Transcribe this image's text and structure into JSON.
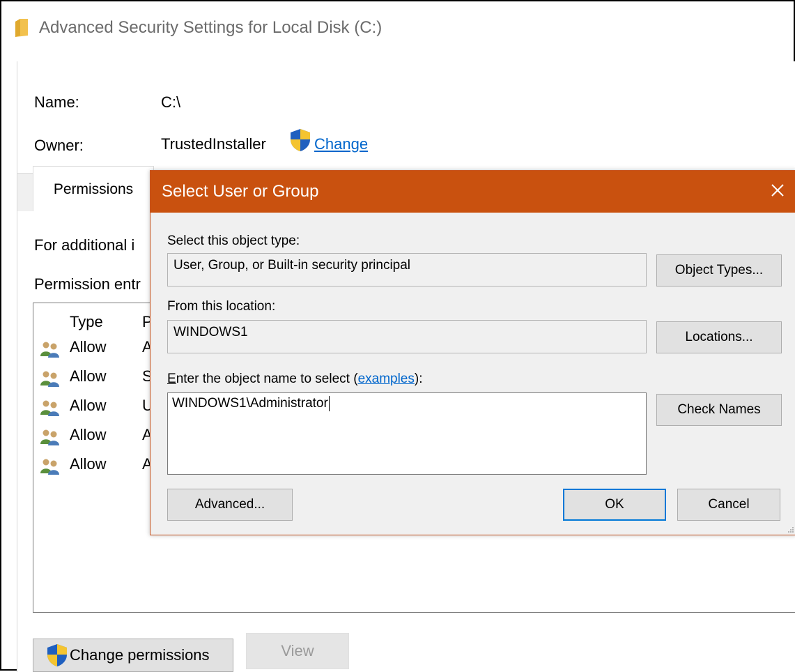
{
  "window": {
    "title": "Advanced Security Settings for Local Disk (C:)",
    "folder_icon_color": "#f2c14e"
  },
  "info": {
    "name_label": "Name:",
    "name_value": "C:\\",
    "owner_label": "Owner:",
    "owner_value": "TrustedInstaller",
    "change_link": "Change"
  },
  "tabs": [
    {
      "label": "Permissions"
    }
  ],
  "permissions_tab": {
    "info_text": "For additional i",
    "entries_text": "Permission entr",
    "columns": [
      "Type",
      "P"
    ],
    "rows": [
      {
        "type": "Allow",
        "principal": "A",
        "icon": "users-icon"
      },
      {
        "type": "Allow",
        "principal": "S",
        "icon": "users-icon"
      },
      {
        "type": "Allow",
        "principal": "U",
        "icon": "users-icon"
      },
      {
        "type": "Allow",
        "principal": "A",
        "icon": "users-icon"
      },
      {
        "type": "Allow",
        "principal": "A",
        "icon": "users-icon"
      }
    ],
    "change_permissions_button": "Change permissions",
    "view_button": "View"
  },
  "dialog": {
    "title": "Select User or Group",
    "title_bar_color": "#c9510f",
    "object_type_label": "Select this object type:",
    "object_type_value": "User, Group, or Built-in security principal",
    "object_types_button": "Object Types...",
    "location_label": "From this location:",
    "location_value": "WINDOWS1",
    "locations_button": "Locations...",
    "enter_name_label_prefix": "nter the object name to select (",
    "enter_name_label_first": "E",
    "examples_link": "examples",
    "enter_name_label_suffix": "):",
    "name_input_value": "WINDOWS1\\Administrator",
    "check_names_button": "Check Names",
    "advanced_button": "Advanced...",
    "ok_button": "OK",
    "cancel_button": "Cancel"
  }
}
